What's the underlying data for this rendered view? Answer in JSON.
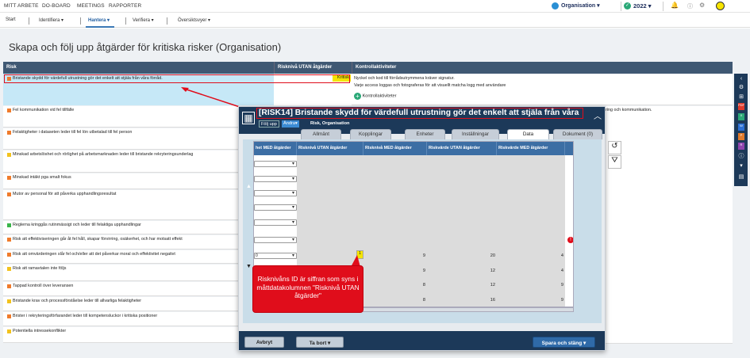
{
  "topnav": {
    "items": [
      "MITT ARBETE",
      "DO-BOARD",
      "MEETINGS",
      "RAPPORTER"
    ],
    "organisation": "Organisation",
    "year": "2022"
  },
  "menubar": {
    "items": [
      "Start",
      "Identifiera",
      "Hantera",
      "Verifiera",
      "Översiktsvyer"
    ]
  },
  "page": {
    "title": "Skapa och följ upp åtgärder för kritiska risker (Organisation)"
  },
  "table": {
    "headers": {
      "risk": "Risk",
      "level": "Risknivå UTAN åtgärder",
      "controls": "Kontrollaktiviteter"
    },
    "risks": [
      {
        "text": "Bristande skydd för värdefull utrustning gör det enkelt att stjäla från våra förråd.",
        "color": "#f07b2b",
        "level": "Kritisk"
      },
      {
        "text": "Fel kommunikation vid fel tillfälle",
        "color": "#f07b2b"
      },
      {
        "text": "Felaktigheter i dataseten leder till fel lön utbetalad till fel person",
        "color": "#f07b2b"
      },
      {
        "text": "Minskad arbetslöshet och rörlighet på arbetsmarknaden leder till bristande rekryteringsunderlag",
        "color": "#f2c21d"
      },
      {
        "text": "Minskad intäkt pga smalt fokus",
        "color": "#f07b2b"
      },
      {
        "text": "Mutor av personal för att påverka upphandlingsresultat",
        "color": "#f07b2b"
      },
      {
        "text": "Reglerna kringgås rutinmässigt och leder till felaktiga upphandlingar",
        "color": "#39b54a"
      },
      {
        "text": "Risk att effektiviseringen går åt fel håll, skapar förvirring, osäkerhet, och har motsatt effekt",
        "color": "#f07b2b"
      },
      {
        "text": "Risk att omvärderingen slår fel och/eller att det påverkar moral och effektivitet negativt",
        "color": "#f07b2b"
      },
      {
        "text": "Risk att ramavtalen inte följs",
        "color": "#f2c21d"
      },
      {
        "text": "Tappad kontroll över leveransen",
        "color": "#f07b2b"
      },
      {
        "text": "Bristande krav och processförståelse leder till allvarliga felaktigheter",
        "color": "#f2c21d"
      },
      {
        "text": "Brister i rekryteringsförfarandet leder till kompetensluckor i kritiska positioner",
        "color": "#f07b2b"
      },
      {
        "text": "Potentiella intressekonflikter",
        "color": "#f2c21d"
      }
    ],
    "control_lines": [
      "Nyckel och kod till förrådsutrymmena kräver signatur.",
      "Varje access loggas och fotograferas för att visuellt matcha logg med användare"
    ],
    "control_button": "Kontrollaktiviteter",
    "control_truncated": "ring och kommunikation."
  },
  "modal": {
    "title": "[RISK14] Bristande skydd för värdefull utrustning gör det enkelt att stjäla från våra",
    "follow_label": "Följ upp",
    "edit_label": "Ändra",
    "subtitle": "Risk, Organisation",
    "tabs": [
      "Allmänt",
      "Kopplingar",
      "Enheter",
      "Inställningar",
      "Data",
      "Dokument (0)"
    ],
    "active_tab": "Data",
    "grid": {
      "headers": [
        "het MED åtgärder",
        "Risknivå UTAN åtgärder",
        "Risknivå MED åtgärder",
        "Riskvärde UTAN åtgärder",
        "Riskvärde MED åtgärder"
      ],
      "rows": [
        {
          "dd": "",
          "a": "",
          "b": "",
          "c": "",
          "d": ""
        },
        {
          "dd": "",
          "a": "",
          "b": "",
          "c": "",
          "d": ""
        },
        {
          "dd": "",
          "a": "",
          "b": "",
          "c": "",
          "d": ""
        },
        {
          "dd": "",
          "a": "",
          "b": "",
          "c": "",
          "d": ""
        },
        {
          "dd": "",
          "a": "",
          "b": "",
          "c": "",
          "d": ""
        },
        {
          "dd": "",
          "a": "",
          "b": "",
          "c": "",
          "d": ""
        },
        {
          "dd": "0",
          "a": "1",
          "b": "9",
          "c": "20",
          "d": "4"
        },
        {
          "dd": "",
          "a": "",
          "b": "9",
          "c": "12",
          "d": "4"
        },
        {
          "dd": "",
          "a": "",
          "b": "8",
          "c": "12",
          "d": "9"
        },
        {
          "dd": "",
          "a": "",
          "b": "8",
          "c": "16",
          "d": "9"
        }
      ]
    },
    "buttons": {
      "cancel": "Avbryt",
      "delete": "Ta bort",
      "save": "Spara och stäng"
    }
  },
  "callout": {
    "text": "Risknivåns ID är siffran som syns i måttdatakolumnen \"Risknivå UTAN åtgärder\""
  },
  "colors": {
    "header": "#3f5873",
    "grid_header": "#3c6ea4",
    "modal_header": "#1c3959",
    "highlight": "#c6e8f7",
    "callout": "#e00d1b",
    "critical": "#f5e400"
  }
}
